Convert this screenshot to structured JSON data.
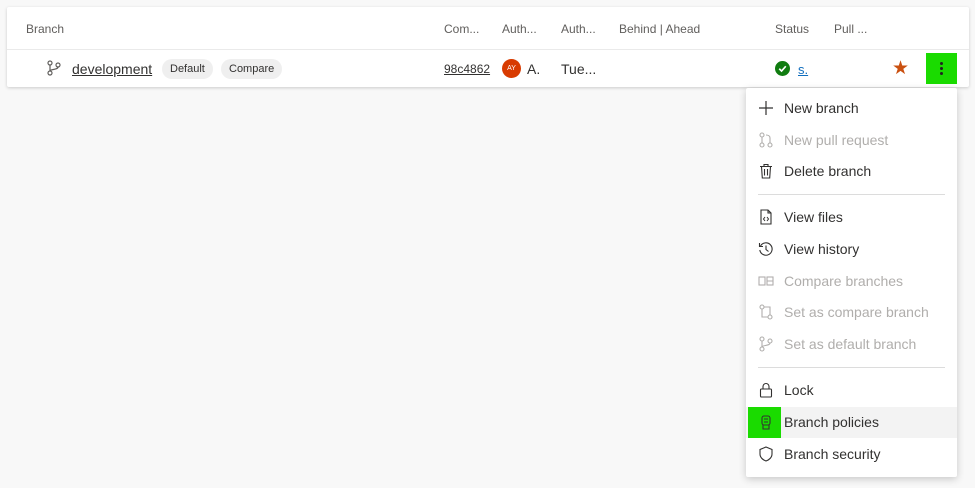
{
  "table": {
    "headers": {
      "branch": "Branch",
      "commit": "Com...",
      "author": "Auth...",
      "authored_date": "Auth...",
      "behind_ahead": "Behind | Ahead",
      "status": "Status",
      "pull_request": "Pull ..."
    },
    "row": {
      "branch_name": "development",
      "default_badge": "Default",
      "compare_badge": "Compare",
      "commit_id": "98c4862",
      "author_initials": "AY",
      "author_name": "A.",
      "authored_date": "Tue...",
      "status_link": "s."
    }
  },
  "menu": {
    "items": [
      {
        "label": "New branch",
        "icon": "plus-icon",
        "enabled": true
      },
      {
        "label": "New pull request",
        "icon": "pull-request-icon",
        "enabled": false
      },
      {
        "label": "Delete branch",
        "icon": "trash-icon",
        "enabled": true
      },
      {
        "label": "View files",
        "icon": "file-code-icon",
        "enabled": true
      },
      {
        "label": "View history",
        "icon": "history-icon",
        "enabled": true
      },
      {
        "label": "Compare branches",
        "icon": "compare-icon",
        "enabled": false
      },
      {
        "label": "Set as compare branch",
        "icon": "compare-branch-icon",
        "enabled": false
      },
      {
        "label": "Set as default branch",
        "icon": "branch-icon",
        "enabled": false
      },
      {
        "label": "Lock",
        "icon": "lock-icon",
        "enabled": true
      },
      {
        "label": "Branch policies",
        "icon": "policy-icon",
        "enabled": true
      },
      {
        "label": "Branch security",
        "icon": "shield-icon",
        "enabled": true
      }
    ]
  },
  "colors": {
    "highlight": "#1adb00",
    "avatar": "#d83b01",
    "star": "#ca5010",
    "status_ok": "#107c10"
  }
}
